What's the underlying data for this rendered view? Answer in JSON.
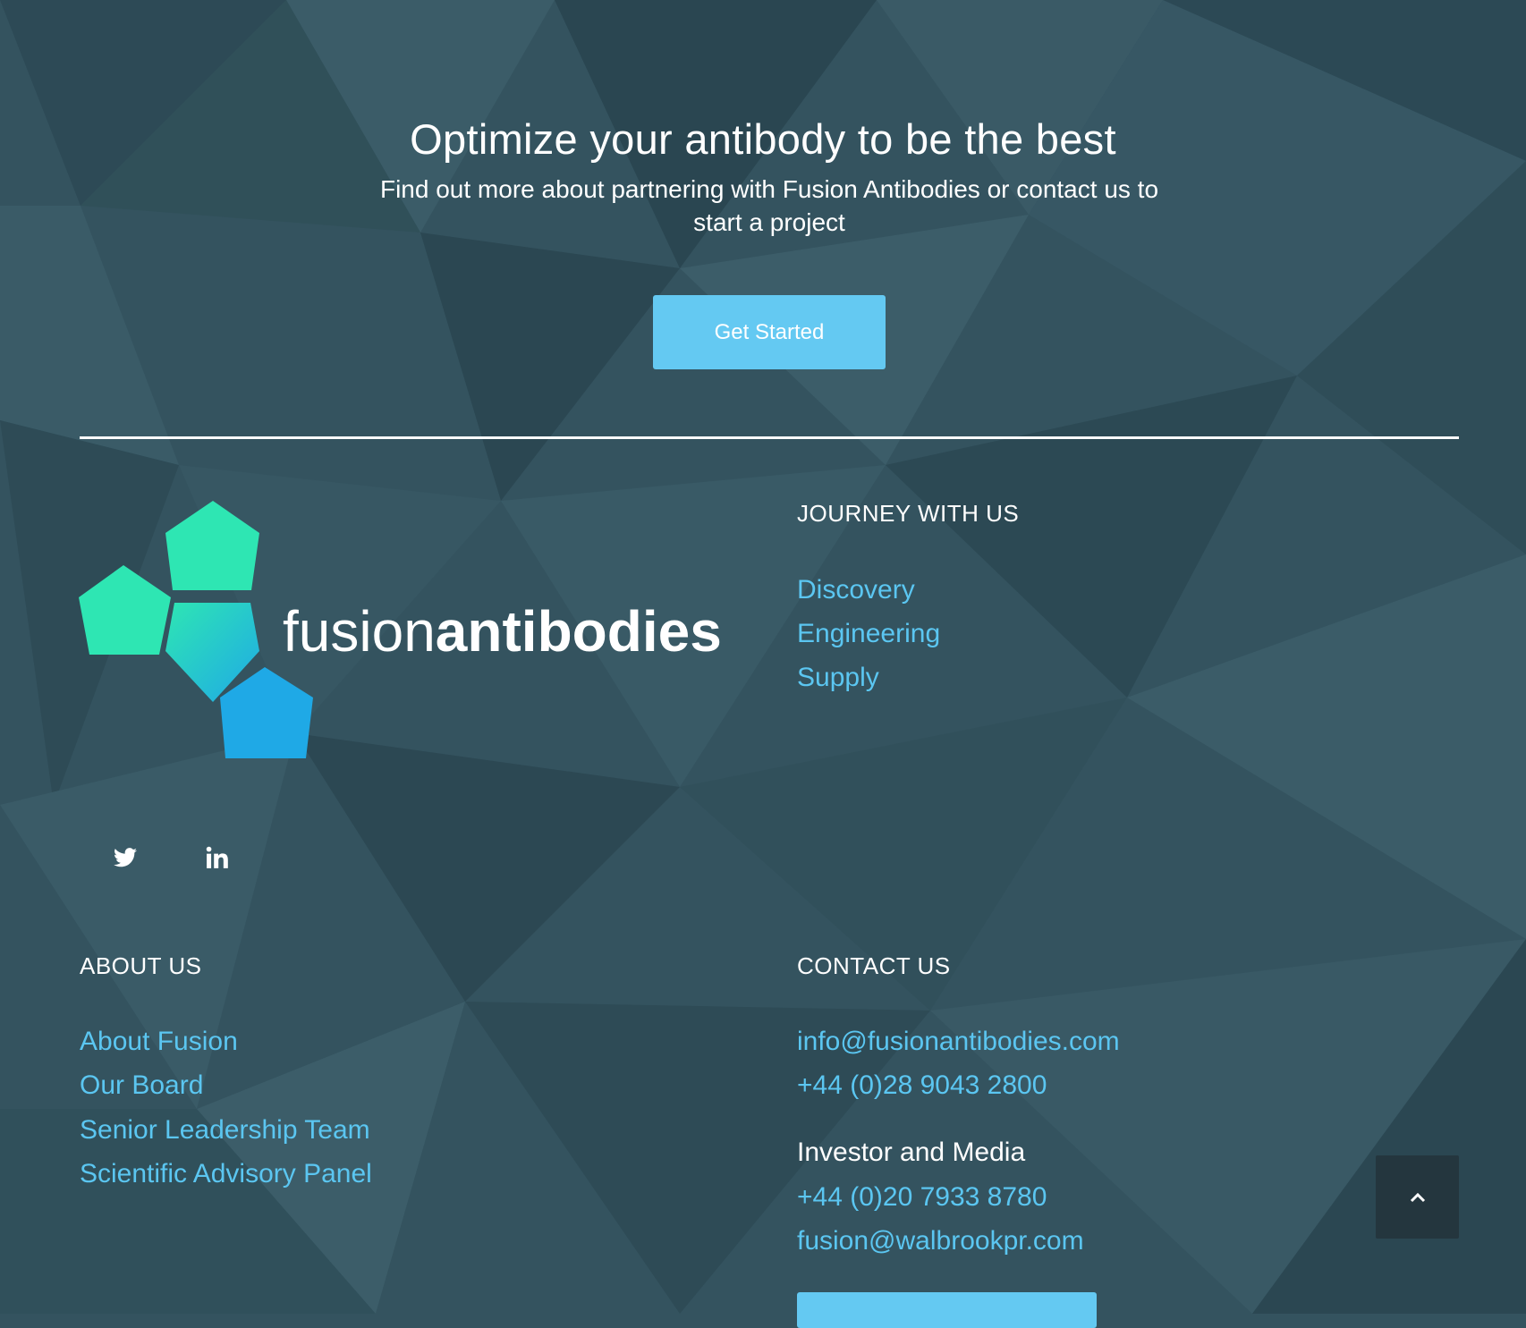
{
  "cta": {
    "heading": "Optimize your antibody to be the best",
    "subheading": "Find out more about partnering with Fusion Antibodies or contact us to start a project",
    "button_label": "Get Started"
  },
  "logo": {
    "text_light": "fusion",
    "text_bold": "antibodies"
  },
  "social": {
    "twitter_icon": "twitter-icon",
    "linkedin_icon": "linkedin-icon"
  },
  "journey": {
    "heading": "JOURNEY WITH US",
    "links": [
      "Discovery",
      "Engineering",
      "Supply"
    ]
  },
  "about": {
    "heading": "ABOUT US",
    "links": [
      "About Fusion",
      "Our Board",
      "Senior Leadership Team",
      "Scientific Advisory Panel"
    ]
  },
  "contact": {
    "heading": "CONTACT US",
    "email": "info@fusionantibodies.com",
    "phone": "+44 (0)28 9043 2800",
    "investor_label": "Investor and Media",
    "investor_phone": "+44 (0)20 7933 8780",
    "investor_email": "fusion@walbrookpr.com"
  },
  "back_to_top_icon": "chevron-up-icon",
  "colors": {
    "background": "#34535f",
    "accent": "#64c9f2",
    "link": "#5bc6f1",
    "back_to_top_bg": "#24363e",
    "logo_green": "#2ee6b3",
    "logo_blue": "#1fa9e6"
  }
}
